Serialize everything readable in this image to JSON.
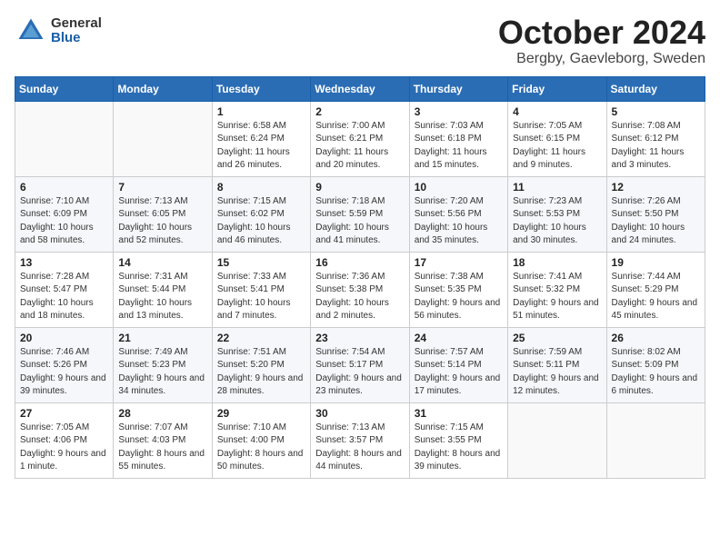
{
  "logo": {
    "general": "General",
    "blue": "Blue"
  },
  "title": "October 2024",
  "location": "Bergby, Gaevleborg, Sweden",
  "days_of_week": [
    "Sunday",
    "Monday",
    "Tuesday",
    "Wednesday",
    "Thursday",
    "Friday",
    "Saturday"
  ],
  "weeks": [
    [
      {
        "day": "",
        "sunrise": "",
        "sunset": "",
        "daylight": ""
      },
      {
        "day": "",
        "sunrise": "",
        "sunset": "",
        "daylight": ""
      },
      {
        "day": "1",
        "sunrise": "Sunrise: 6:58 AM",
        "sunset": "Sunset: 6:24 PM",
        "daylight": "Daylight: 11 hours and 26 minutes."
      },
      {
        "day": "2",
        "sunrise": "Sunrise: 7:00 AM",
        "sunset": "Sunset: 6:21 PM",
        "daylight": "Daylight: 11 hours and 20 minutes."
      },
      {
        "day": "3",
        "sunrise": "Sunrise: 7:03 AM",
        "sunset": "Sunset: 6:18 PM",
        "daylight": "Daylight: 11 hours and 15 minutes."
      },
      {
        "day": "4",
        "sunrise": "Sunrise: 7:05 AM",
        "sunset": "Sunset: 6:15 PM",
        "daylight": "Daylight: 11 hours and 9 minutes."
      },
      {
        "day": "5",
        "sunrise": "Sunrise: 7:08 AM",
        "sunset": "Sunset: 6:12 PM",
        "daylight": "Daylight: 11 hours and 3 minutes."
      }
    ],
    [
      {
        "day": "6",
        "sunrise": "Sunrise: 7:10 AM",
        "sunset": "Sunset: 6:09 PM",
        "daylight": "Daylight: 10 hours and 58 minutes."
      },
      {
        "day": "7",
        "sunrise": "Sunrise: 7:13 AM",
        "sunset": "Sunset: 6:05 PM",
        "daylight": "Daylight: 10 hours and 52 minutes."
      },
      {
        "day": "8",
        "sunrise": "Sunrise: 7:15 AM",
        "sunset": "Sunset: 6:02 PM",
        "daylight": "Daylight: 10 hours and 46 minutes."
      },
      {
        "day": "9",
        "sunrise": "Sunrise: 7:18 AM",
        "sunset": "Sunset: 5:59 PM",
        "daylight": "Daylight: 10 hours and 41 minutes."
      },
      {
        "day": "10",
        "sunrise": "Sunrise: 7:20 AM",
        "sunset": "Sunset: 5:56 PM",
        "daylight": "Daylight: 10 hours and 35 minutes."
      },
      {
        "day": "11",
        "sunrise": "Sunrise: 7:23 AM",
        "sunset": "Sunset: 5:53 PM",
        "daylight": "Daylight: 10 hours and 30 minutes."
      },
      {
        "day": "12",
        "sunrise": "Sunrise: 7:26 AM",
        "sunset": "Sunset: 5:50 PM",
        "daylight": "Daylight: 10 hours and 24 minutes."
      }
    ],
    [
      {
        "day": "13",
        "sunrise": "Sunrise: 7:28 AM",
        "sunset": "Sunset: 5:47 PM",
        "daylight": "Daylight: 10 hours and 18 minutes."
      },
      {
        "day": "14",
        "sunrise": "Sunrise: 7:31 AM",
        "sunset": "Sunset: 5:44 PM",
        "daylight": "Daylight: 10 hours and 13 minutes."
      },
      {
        "day": "15",
        "sunrise": "Sunrise: 7:33 AM",
        "sunset": "Sunset: 5:41 PM",
        "daylight": "Daylight: 10 hours and 7 minutes."
      },
      {
        "day": "16",
        "sunrise": "Sunrise: 7:36 AM",
        "sunset": "Sunset: 5:38 PM",
        "daylight": "Daylight: 10 hours and 2 minutes."
      },
      {
        "day": "17",
        "sunrise": "Sunrise: 7:38 AM",
        "sunset": "Sunset: 5:35 PM",
        "daylight": "Daylight: 9 hours and 56 minutes."
      },
      {
        "day": "18",
        "sunrise": "Sunrise: 7:41 AM",
        "sunset": "Sunset: 5:32 PM",
        "daylight": "Daylight: 9 hours and 51 minutes."
      },
      {
        "day": "19",
        "sunrise": "Sunrise: 7:44 AM",
        "sunset": "Sunset: 5:29 PM",
        "daylight": "Daylight: 9 hours and 45 minutes."
      }
    ],
    [
      {
        "day": "20",
        "sunrise": "Sunrise: 7:46 AM",
        "sunset": "Sunset: 5:26 PM",
        "daylight": "Daylight: 9 hours and 39 minutes."
      },
      {
        "day": "21",
        "sunrise": "Sunrise: 7:49 AM",
        "sunset": "Sunset: 5:23 PM",
        "daylight": "Daylight: 9 hours and 34 minutes."
      },
      {
        "day": "22",
        "sunrise": "Sunrise: 7:51 AM",
        "sunset": "Sunset: 5:20 PM",
        "daylight": "Daylight: 9 hours and 28 minutes."
      },
      {
        "day": "23",
        "sunrise": "Sunrise: 7:54 AM",
        "sunset": "Sunset: 5:17 PM",
        "daylight": "Daylight: 9 hours and 23 minutes."
      },
      {
        "day": "24",
        "sunrise": "Sunrise: 7:57 AM",
        "sunset": "Sunset: 5:14 PM",
        "daylight": "Daylight: 9 hours and 17 minutes."
      },
      {
        "day": "25",
        "sunrise": "Sunrise: 7:59 AM",
        "sunset": "Sunset: 5:11 PM",
        "daylight": "Daylight: 9 hours and 12 minutes."
      },
      {
        "day": "26",
        "sunrise": "Sunrise: 8:02 AM",
        "sunset": "Sunset: 5:09 PM",
        "daylight": "Daylight: 9 hours and 6 minutes."
      }
    ],
    [
      {
        "day": "27",
        "sunrise": "Sunrise: 7:05 AM",
        "sunset": "Sunset: 4:06 PM",
        "daylight": "Daylight: 9 hours and 1 minute."
      },
      {
        "day": "28",
        "sunrise": "Sunrise: 7:07 AM",
        "sunset": "Sunset: 4:03 PM",
        "daylight": "Daylight: 8 hours and 55 minutes."
      },
      {
        "day": "29",
        "sunrise": "Sunrise: 7:10 AM",
        "sunset": "Sunset: 4:00 PM",
        "daylight": "Daylight: 8 hours and 50 minutes."
      },
      {
        "day": "30",
        "sunrise": "Sunrise: 7:13 AM",
        "sunset": "Sunset: 3:57 PM",
        "daylight": "Daylight: 8 hours and 44 minutes."
      },
      {
        "day": "31",
        "sunrise": "Sunrise: 7:15 AM",
        "sunset": "Sunset: 3:55 PM",
        "daylight": "Daylight: 8 hours and 39 minutes."
      },
      {
        "day": "",
        "sunrise": "",
        "sunset": "",
        "daylight": ""
      },
      {
        "day": "",
        "sunrise": "",
        "sunset": "",
        "daylight": ""
      }
    ]
  ]
}
